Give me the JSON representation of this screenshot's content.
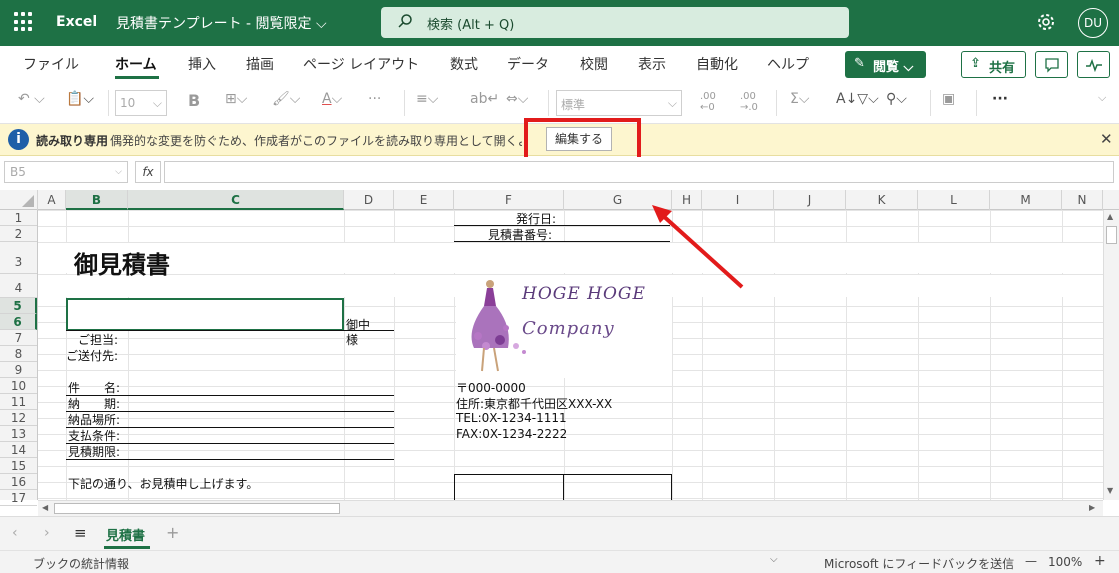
{
  "header": {
    "app_name": "Excel",
    "doc_title": "見積書テンプレート - 閲覧限定 ⌵",
    "search_placeholder": "検索 (Alt + Q)",
    "avatar_initials": "DU"
  },
  "ribbon": {
    "tabs": [
      "ファイル",
      "ホーム",
      "挿入",
      "描画",
      "ページ レイアウト",
      "数式",
      "データ",
      "校閲",
      "表示",
      "自動化",
      "ヘルプ"
    ],
    "active_tab": "ホーム",
    "view_button": "閲覧 ⌵",
    "share_button": "共有"
  },
  "toolbar": {
    "font_size": "10",
    "number_format": "標準",
    "bold_label": "B",
    "more_label": "···"
  },
  "infobar": {
    "title": "読み取り専用",
    "message": "偶発的な変更を防ぐため、作成者がこのファイルを読み取り専用として開くよう設定しまし",
    "edit_button": "編集する",
    "close_label": "✕"
  },
  "formula_bar": {
    "name_box": "B5",
    "fx_label": "fx",
    "formula": ""
  },
  "columns": [
    "A",
    "B",
    "C",
    "D",
    "E",
    "F",
    "G",
    "H",
    "I",
    "J",
    "K",
    "L",
    "M",
    "N"
  ],
  "selected_column": "B",
  "rows": [
    "1",
    "2",
    "3",
    "4",
    "5",
    "6",
    "7",
    "8",
    "9",
    "10",
    "11",
    "12",
    "13",
    "14",
    "15",
    "16",
    "17"
  ],
  "selected_rows": [
    "5",
    "6"
  ],
  "sheet": {
    "issue_date_label": "発行日:",
    "quote_no_label": "見積書番号:",
    "title": "御見積書",
    "honorific_1": "御中",
    "honorific_2": "様",
    "contact_label": "ご担当:",
    "recipient_label": "ご送付先:",
    "subject_label": "件　　名:",
    "delivery_label": "納　　期:",
    "place_label": "納品場所:",
    "payment_label": "支払条件:",
    "validity_label": "見積期限:",
    "intro_text": "下記の通り、お見積申し上げます。",
    "company_logo_line1": "HOGE HOGE",
    "company_logo_line2": "Company",
    "postal": "〒000-0000",
    "address": "住所:東京都千代田区XXX-XX",
    "tel": "TEL:0X-1234-1111",
    "fax": "FAX:0X-1234-2222"
  },
  "sheet_tabs": {
    "active": "見積書",
    "add_label": "+"
  },
  "statusbar": {
    "left_text": "ブックの統計情報",
    "feedback": "Microsoft にフィードバックを送信",
    "zoom": "100%",
    "zoom_minus": "—",
    "zoom_plus": "+"
  },
  "colors": {
    "brand": "#1e7145",
    "infobar": "#fdf6cf",
    "highlight": "#e21b1b"
  }
}
